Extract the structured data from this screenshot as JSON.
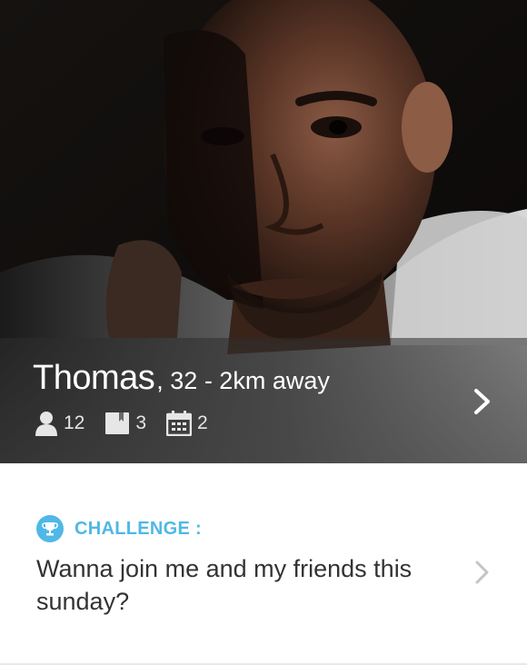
{
  "profile": {
    "name": "Thomas",
    "meta": ", 32 - 2km away",
    "photo_icon": "profile-photo",
    "stats": [
      {
        "icon": "person-icon",
        "value": "12"
      },
      {
        "icon": "book-icon",
        "value": "3"
      },
      {
        "icon": "calendar-icon",
        "value": "2"
      }
    ],
    "open_icon": "chevron-right-icon"
  },
  "challenge": {
    "icon": "trophy-icon",
    "label": "CHALLENGE :",
    "text": "Wanna join me and my friends this sunday?",
    "open_icon": "chevron-right-icon"
  },
  "colors": {
    "accent": "#4fb8e6",
    "text_dark": "#333333",
    "overlay_text": "#ffffff"
  }
}
